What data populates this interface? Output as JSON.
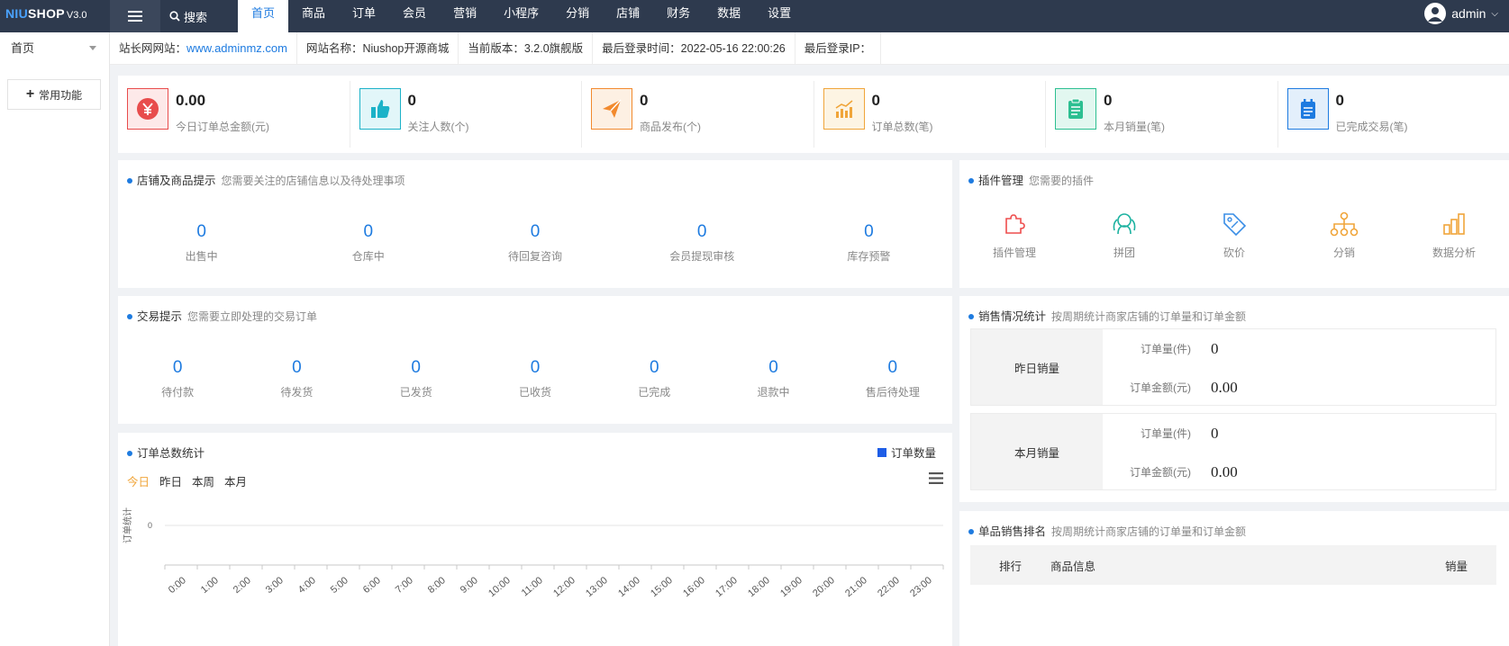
{
  "logo": {
    "part1": "NIU",
    "part2": "SHOP",
    "version": "V3.0"
  },
  "search_label": "搜索",
  "nav": [
    "首页",
    "商品",
    "订单",
    "会员",
    "营销",
    "小程序",
    "分销",
    "店铺",
    "财务",
    "数据",
    "设置"
  ],
  "user": {
    "name": "admin"
  },
  "sidebar": {
    "title": "首页",
    "common_label": "常用功能"
  },
  "info": {
    "site_label": "站长网网站：",
    "site_link": "www.adminmz.com",
    "name": "网站名称：Niushop开源商城",
    "version": "当前版本：3.2.0旗舰版",
    "last_login_time": "最后登录时间：2022-05-16 22:00:26",
    "last_login_ip": "最后登录IP："
  },
  "stats": [
    {
      "value": "0.00",
      "label": "今日订单总金额(元)",
      "icon": "yen-icon",
      "color": "#e84c4c",
      "bg": "#fde9e9"
    },
    {
      "value": "0",
      "label": "关注人数(个)",
      "icon": "thumbs-up-icon",
      "color": "#1cb2c8",
      "bg": "#e2f6f9"
    },
    {
      "value": "0",
      "label": "商品发布(个)",
      "icon": "paper-plane-icon",
      "color": "#f28a2e",
      "bg": "#fdf0e3"
    },
    {
      "value": "0",
      "label": "订单总数(笔)",
      "icon": "trend-chart-icon",
      "color": "#f0a53a",
      "bg": "#fdf4e3"
    },
    {
      "value": "0",
      "label": "本月销量(笔)",
      "icon": "clipboard-icon",
      "color": "#2cbf91",
      "bg": "#e2f7f0"
    },
    {
      "value": "0",
      "label": "已完成交易(笔)",
      "icon": "check-list-icon",
      "color": "#1e7be0",
      "bg": "#e3effb"
    }
  ],
  "shop_panel": {
    "title": "店铺及商品提示",
    "subtitle": "您需要关注的店铺信息以及待处理事项",
    "items": [
      {
        "value": "0",
        "label": "出售中"
      },
      {
        "value": "0",
        "label": "仓库中"
      },
      {
        "value": "0",
        "label": "待回复咨询"
      },
      {
        "value": "0",
        "label": "会员提现审核"
      },
      {
        "value": "0",
        "label": "库存预警"
      }
    ]
  },
  "trade_panel": {
    "title": "交易提示",
    "subtitle": "您需要立即处理的交易订单",
    "items": [
      {
        "value": "0",
        "label": "待付款"
      },
      {
        "value": "0",
        "label": "待发货"
      },
      {
        "value": "0",
        "label": "已发货"
      },
      {
        "value": "0",
        "label": "已收货"
      },
      {
        "value": "0",
        "label": "已完成"
      },
      {
        "value": "0",
        "label": "退款中"
      },
      {
        "value": "0",
        "label": "售后待处理"
      }
    ]
  },
  "plugin_panel": {
    "title": "插件管理",
    "subtitle": "您需要的插件",
    "items": [
      {
        "label": "插件管理",
        "icon": "puzzle-icon",
        "color": "#ee4d4d"
      },
      {
        "label": "拼团",
        "icon": "group-icon",
        "color": "#1cb2a0"
      },
      {
        "label": "砍价",
        "icon": "tag-icon",
        "color": "#3a8ee6"
      },
      {
        "label": "分销",
        "icon": "hierarchy-icon",
        "color": "#f0a53a"
      },
      {
        "label": "数据分析",
        "icon": "bar-chart-icon",
        "color": "#f0a53a"
      }
    ]
  },
  "sales_panel": {
    "title": "销售情况统计",
    "subtitle": "按周期统计商家店铺的订单量和订单金额",
    "blocks": [
      {
        "label": "昨日销量",
        "rows": [
          {
            "key": "订单量(件)",
            "value": "0"
          },
          {
            "key": "订单金额(元)",
            "value": "0.00"
          }
        ]
      },
      {
        "label": "本月销量",
        "rows": [
          {
            "key": "订单量(件)",
            "value": "0"
          },
          {
            "key": "订单金额(元)",
            "value": "0.00"
          }
        ]
      }
    ]
  },
  "rank_panel": {
    "title": "单品销售排名",
    "subtitle": "按周期统计商家店铺的订单量和订单金额",
    "columns": [
      "排行",
      "商品信息",
      "销量"
    ]
  },
  "order_chart_panel": {
    "title": "订单总数统计",
    "tabs": [
      "今日",
      "昨日",
      "本周",
      "本月"
    ],
    "active_tab": 0
  },
  "chart_data": {
    "type": "line",
    "title": "订单总数统计",
    "ylabel": "订单统计",
    "xlabel": "",
    "x": [
      "0:00",
      "1:00",
      "2:00",
      "3:00",
      "4:00",
      "5:00",
      "6:00",
      "7:00",
      "8:00",
      "9:00",
      "10:00",
      "11:00",
      "12:00",
      "13:00",
      "14:00",
      "15:00",
      "16:00",
      "17:00",
      "18:00",
      "19:00",
      "20:00",
      "21:00",
      "22:00",
      "23:00"
    ],
    "series": [
      {
        "name": "订单数量",
        "values": [
          0,
          0,
          0,
          0,
          0,
          0,
          0,
          0,
          0,
          0,
          0,
          0,
          0,
          0,
          0,
          0,
          0,
          0,
          0,
          0,
          0,
          0,
          0,
          0
        ],
        "color": "#1e5de6"
      }
    ],
    "yticks": [
      "0"
    ],
    "grid": true,
    "legend": "top-right"
  }
}
